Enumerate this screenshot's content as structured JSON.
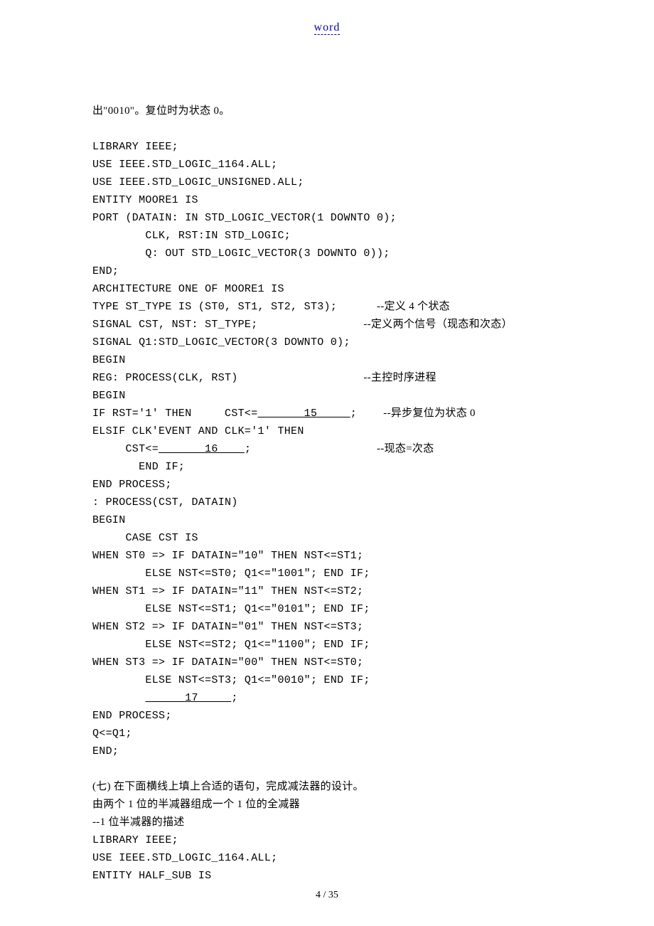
{
  "header": {
    "link": "word"
  },
  "intro": {
    "line1": "出\"0010\"。复位时为状态 0。"
  },
  "code1": {
    "l01": "LIBRARY IEEE;",
    "l02": "USE IEEE.STD_LOGIC_1164.ALL;",
    "l03": "USE IEEE.STD_LOGIC_UNSIGNED.ALL;",
    "l04": "ENTITY MOORE1 IS",
    "l05": "PORT (DATAIN: IN STD_LOGIC_VECTOR(1 DOWNTO 0);",
    "l06": "        CLK, RST:IN STD_LOGIC;",
    "l07": "        Q: OUT STD_LOGIC_VECTOR(3 DOWNTO 0));",
    "l08": "END;",
    "l09": "ARCHITECTURE ONE OF MOORE1 IS",
    "l10a": "TYPE ST_TYPE IS (ST0, ST1, ST2, ST3);      ",
    "l10b": "--定义 4 个状态",
    "l11a": "SIGNAL CST, NST: ST_TYPE;                ",
    "l11b": "--定义两个信号（现态和次态）",
    "l12": "SIGNAL Q1:STD_LOGIC_VECTOR(3 DOWNTO 0);",
    "l13": "BEGIN",
    "l14a": "REG: PROCESS(CLK, RST)                   ",
    "l14b": "--主控时序进程",
    "l15": "BEGIN",
    "l16a": "IF RST='1' THEN     CST<=",
    "l16b": "       15     ",
    "l16c": ";    ",
    "l16d": "--异步复位为状态 0",
    "l17": "ELSIF CLK'EVENT AND CLK='1' THEN",
    "l18a": "     CST<=",
    "l18b": "       16    ",
    "l18c": ";                   ",
    "l18d": "--现态=次态",
    "l19": "       END IF;",
    "l20": "END PROCESS;",
    "l21": ": PROCESS(CST, DATAIN)",
    "l22": "BEGIN",
    "l23": "     CASE CST IS",
    "l24": "WHEN ST0 => IF DATAIN=\"10\" THEN NST<=ST1;",
    "l25": "        ELSE NST<=ST0; Q1<=\"1001\"; END IF;",
    "l26": "WHEN ST1 => IF DATAIN=\"11\" THEN NST<=ST2;",
    "l27": "        ELSE NST<=ST1; Q1<=\"0101\"; END IF;",
    "l28": "WHEN ST2 => IF DATAIN=\"01\" THEN NST<=ST3;",
    "l29": "        ELSE NST<=ST2; Q1<=\"1100\"; END IF;",
    "l30": "WHEN ST3 => IF DATAIN=\"00\" THEN NST<=ST0;",
    "l31": "        ELSE NST<=ST3; Q1<=\"0010\"; END IF;",
    "l32a": "        ",
    "l32b": "      17     ",
    "l32c": ";",
    "l33": "END PROCESS;",
    "l34": "Q<=Q1;",
    "l35": "END;"
  },
  "section7": {
    "title": "(七) 在下面横线上填上合适的语句，完成减法器的设计。",
    "sub": "由两个 1 位的半减器组成一个 1 位的全减器",
    "comment": "--1 位半减器的描述",
    "c1": "LIBRARY IEEE;",
    "c2": "USE IEEE.STD_LOGIC_1164.ALL;",
    "c3": "ENTITY HALF_SUB IS"
  },
  "footer": {
    "page": "4 / 35"
  }
}
